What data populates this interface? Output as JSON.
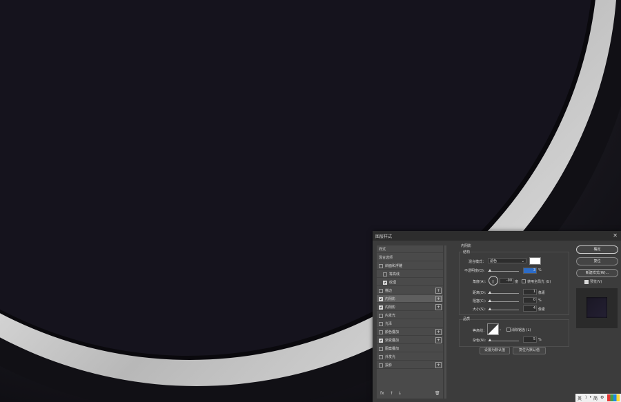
{
  "dialog": {
    "title": "图层样式",
    "close_label": "✕"
  },
  "styles_list": {
    "items": [
      {
        "label": "样式",
        "checkbox": null,
        "plus": false
      },
      {
        "label": "混合选项",
        "checkbox": null,
        "plus": false
      },
      {
        "label": "斜面和浮雕",
        "checkbox": false,
        "plus": false
      },
      {
        "label": "等高线",
        "checkbox": false,
        "plus": false,
        "indent": true
      },
      {
        "label": "纹理",
        "checkbox": true,
        "plus": false,
        "indent": true
      },
      {
        "label": "描边",
        "checkbox": false,
        "plus": true
      },
      {
        "label": "内阴影",
        "checkbox": true,
        "plus": true,
        "selected": true
      },
      {
        "label": "内阴影",
        "checkbox": true,
        "plus": true
      },
      {
        "label": "内发光",
        "checkbox": false,
        "plus": false
      },
      {
        "label": "光泽",
        "checkbox": false,
        "plus": false
      },
      {
        "label": "颜色叠加",
        "checkbox": false,
        "plus": true
      },
      {
        "label": "渐变叠加",
        "checkbox": true,
        "plus": true
      },
      {
        "label": "图案叠加",
        "checkbox": false,
        "plus": false
      },
      {
        "label": "外发光",
        "checkbox": false,
        "plus": false
      },
      {
        "label": "投影",
        "checkbox": false,
        "plus": true
      }
    ],
    "bottom": {
      "fx": "fx",
      "up": "↑",
      "down": "↓",
      "trash": "🗑"
    }
  },
  "inner_shadow": {
    "section_title": "内阴影",
    "structure_title": "结构",
    "blend_mode_label": "混合模式：",
    "blend_mode_value": "滤色",
    "swatch_color": "#ffffff",
    "opacity_label": "不透明度(O):",
    "opacity_value": "3",
    "opacity_unit": "%",
    "angle_label": "角度(A):",
    "angle_value": "-90",
    "angle_unit": "度",
    "global_light_label": "使用全局光 (G)",
    "distance_label": "距离(D):",
    "distance_value": "1",
    "distance_unit": "像素",
    "choke_label": "阻塞(C):",
    "choke_value": "0",
    "choke_unit": "%",
    "size_label": "大小(S):",
    "size_value": "4",
    "size_unit": "像素",
    "quality_title": "品质",
    "contour_label": "等高线：",
    "antialias_label": "消除锯齿 (L)",
    "noise_label": "杂色(N):",
    "noise_value": "5",
    "noise_unit": "%",
    "set_default_label": "设置为默认值",
    "reset_default_label": "复位为默认值"
  },
  "right_panel": {
    "ok_label": "确定",
    "reset_label": "复位",
    "new_style_label": "新建样式(W)...",
    "preview_label": "预览(V)"
  },
  "tray": {
    "ime": "英",
    "moon": "☽",
    "dot": "•",
    "simplified": "简",
    "gear": "⚙"
  }
}
